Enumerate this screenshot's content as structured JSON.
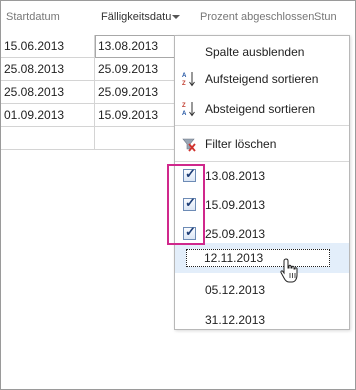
{
  "header": {
    "col_start": "Startdatum",
    "col_due": "Fälligkeitsdatu",
    "col_percent": "Prozent abgeschlossen",
    "col_hours": "Stun"
  },
  "rows": [
    {
      "start": "15.06.2013",
      "due": "13.08.2013"
    },
    {
      "start": "25.08.2013",
      "due": "25.09.2013"
    },
    {
      "start": "25.08.2013",
      "due": "25.09.2013"
    },
    {
      "start": "01.09.2013",
      "due": "15.09.2013"
    },
    {
      "start": "",
      "due": ""
    }
  ],
  "menu": {
    "hide_column": "Spalte ausblenden",
    "sort_asc": "Aufsteigend sortieren",
    "sort_desc": "Absteigend sortieren",
    "clear_filter": "Filter löschen",
    "sort_asc_icon": "sort-ascending-icon",
    "sort_desc_icon": "sort-descending-icon",
    "clear_filter_icon": "filter-clear-icon"
  },
  "filter_values": [
    {
      "label": "13.08.2013",
      "checked": true
    },
    {
      "label": "15.09.2013",
      "checked": true
    },
    {
      "label": "25.09.2013",
      "checked": true
    },
    {
      "label": "12.11.2013",
      "checked": false
    },
    {
      "label": "05.12.2013",
      "checked": false
    },
    {
      "label": "31.12.2013",
      "checked": false
    }
  ],
  "colors": {
    "highlight_border": "#d0288c",
    "hover_bg": "#e3eefa",
    "checkbox_tick": "#1f3f77"
  }
}
